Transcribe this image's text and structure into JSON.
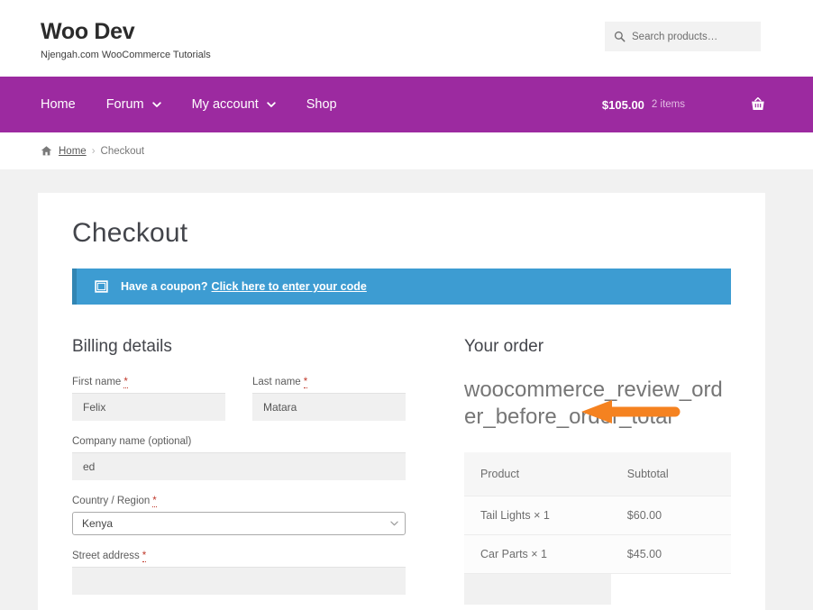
{
  "site": {
    "brand_title": "Woo Dev",
    "tagline": "Njengah.com WooCommerce Tutorials",
    "search_placeholder": "Search products…",
    "search_value": "",
    "search_icon": "search-icon"
  },
  "nav": {
    "items": [
      {
        "label": "Home",
        "has_dropdown": false
      },
      {
        "label": "Forum",
        "has_dropdown": true
      },
      {
        "label": "My account",
        "has_dropdown": true
      },
      {
        "label": "Shop",
        "has_dropdown": false
      }
    ],
    "cart": {
      "amount": "$105.00",
      "count": "2 items",
      "icon": "shopping-basket-icon"
    },
    "background_color": "#9c2aa0"
  },
  "breadcrumb": {
    "home_icon": "home-icon",
    "home_label": "Home",
    "separator": "›",
    "current": "Checkout"
  },
  "page": {
    "title": "Checkout"
  },
  "coupon": {
    "icon": "coupon-tag-icon",
    "text": "Have a coupon?",
    "link_label": "Click here to enter your code",
    "background_color": "#3d9cd2",
    "border_color": "#3185b3"
  },
  "billing": {
    "title": "Billing details",
    "required_mark": "*",
    "fields": [
      {
        "label": "First name",
        "required": true,
        "value": "Felix",
        "type": "text"
      },
      {
        "label": "Last name",
        "required": true,
        "value": "Matara",
        "type": "text"
      },
      {
        "label": "Company name (optional)",
        "required": false,
        "value": "ed",
        "type": "text"
      },
      {
        "label": "Country / Region",
        "required": true,
        "value": "Kenya",
        "type": "select"
      },
      {
        "label": "Street address",
        "required": true,
        "value": "",
        "type": "text"
      }
    ]
  },
  "order": {
    "title": "Your order",
    "hook_name": "woocommerce_review_order_before_order_total",
    "annotation": {
      "shape": "left-arrow",
      "color": "#f58220"
    },
    "table": {
      "headers": [
        "Product",
        "Subtotal"
      ],
      "rows": [
        {
          "product": "Tail Lights",
          "qty": "× 1",
          "subtotal": "$60.00"
        },
        {
          "product": "Car Parts",
          "qty": "× 1",
          "subtotal": "$45.00"
        }
      ]
    }
  }
}
